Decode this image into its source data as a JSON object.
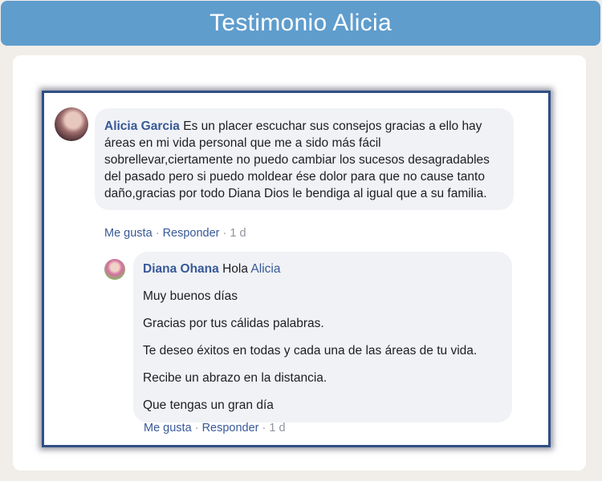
{
  "header": {
    "title": "Testimonio Alicia"
  },
  "comment": {
    "author": "Alicia Garcia",
    "text": "Es un placer escuchar sus consejos gracias a ello hay áreas en mi vida personal que me a sido más fácil sobrellevar,ciertamente no puedo cambiar los sucesos desagradables del pasado pero si puedo moldear ése dolor para que no cause tanto daño,gracias por todo Diana Dios le bendiga al igual que a su familia.",
    "like_label": "Me gusta",
    "reply_label": "Responder",
    "time": "1 d"
  },
  "reply": {
    "author": "Diana Ohana",
    "greeting": "Hola",
    "mention": "Alicia",
    "lines": [
      "Muy buenos días",
      "Gracias por tus cálidas palabras.",
      "Te deseo éxitos en todas y cada una de las áreas de tu vida.",
      "Recibe un abrazo en la distancia.",
      "Que tengas un gran día"
    ],
    "like_label": "Me gusta",
    "reply_label": "Responder",
    "time": "1 d"
  },
  "separator": "·",
  "colors": {
    "title_bar": "#5f9dcd",
    "frame_border": "#2f4f86",
    "link": "#385898",
    "bubble": "#f0f2f5"
  }
}
